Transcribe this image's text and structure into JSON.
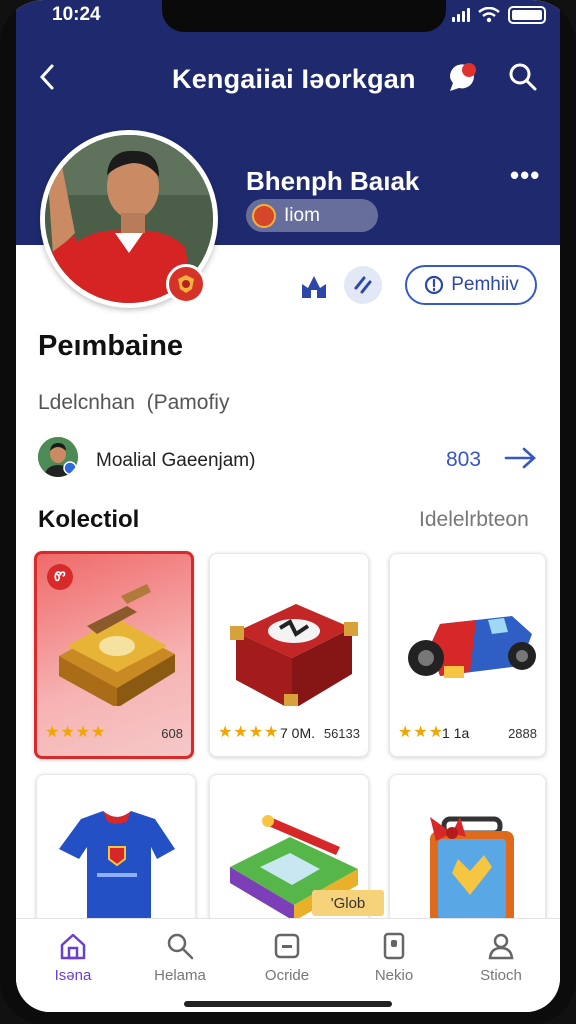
{
  "status_bar": {
    "time": "10:24"
  },
  "nav": {
    "title": "Kengaiiai Iəorkgan"
  },
  "profile": {
    "name": "Bhenph Baıak",
    "chip_label": "Iiom",
    "follow_label": "Pemhiiv"
  },
  "page": {
    "title": "Peımbaine",
    "subtitle": "Ldelcnhan  (Pamofiy",
    "owner_name": "Moalial Gaeenjam)",
    "owner_count": "803"
  },
  "collection": {
    "title": "Kolectiol",
    "link": "Idelelrbteon",
    "cards": [
      {
        "stars": "★★★★",
        "meta": "",
        "value": "608"
      },
      {
        "stars": "★★★★",
        "meta": "7 0M.",
        "value": "56133"
      },
      {
        "stars": "★★★",
        "meta": "1 1a",
        "value": "2888"
      },
      {
        "stars": "",
        "meta": "",
        "value": ""
      },
      {
        "stars": "",
        "meta": "",
        "value": "",
        "tag": "'Glob"
      },
      {
        "stars": "",
        "meta": "",
        "value": ""
      }
    ],
    "featured_badge": "Ꮫ"
  },
  "tabs": [
    {
      "label": "Isəna",
      "active": true
    },
    {
      "label": "Helama",
      "active": false
    },
    {
      "label": "Ocride",
      "active": false
    },
    {
      "label": "Nekio",
      "active": false
    },
    {
      "label": "Stioch",
      "active": false
    }
  ],
  "colors": {
    "header": "#1f2a6e",
    "accent": "#3556c4",
    "active_tab": "#6a3fd0",
    "featured": "#d72a2a"
  }
}
